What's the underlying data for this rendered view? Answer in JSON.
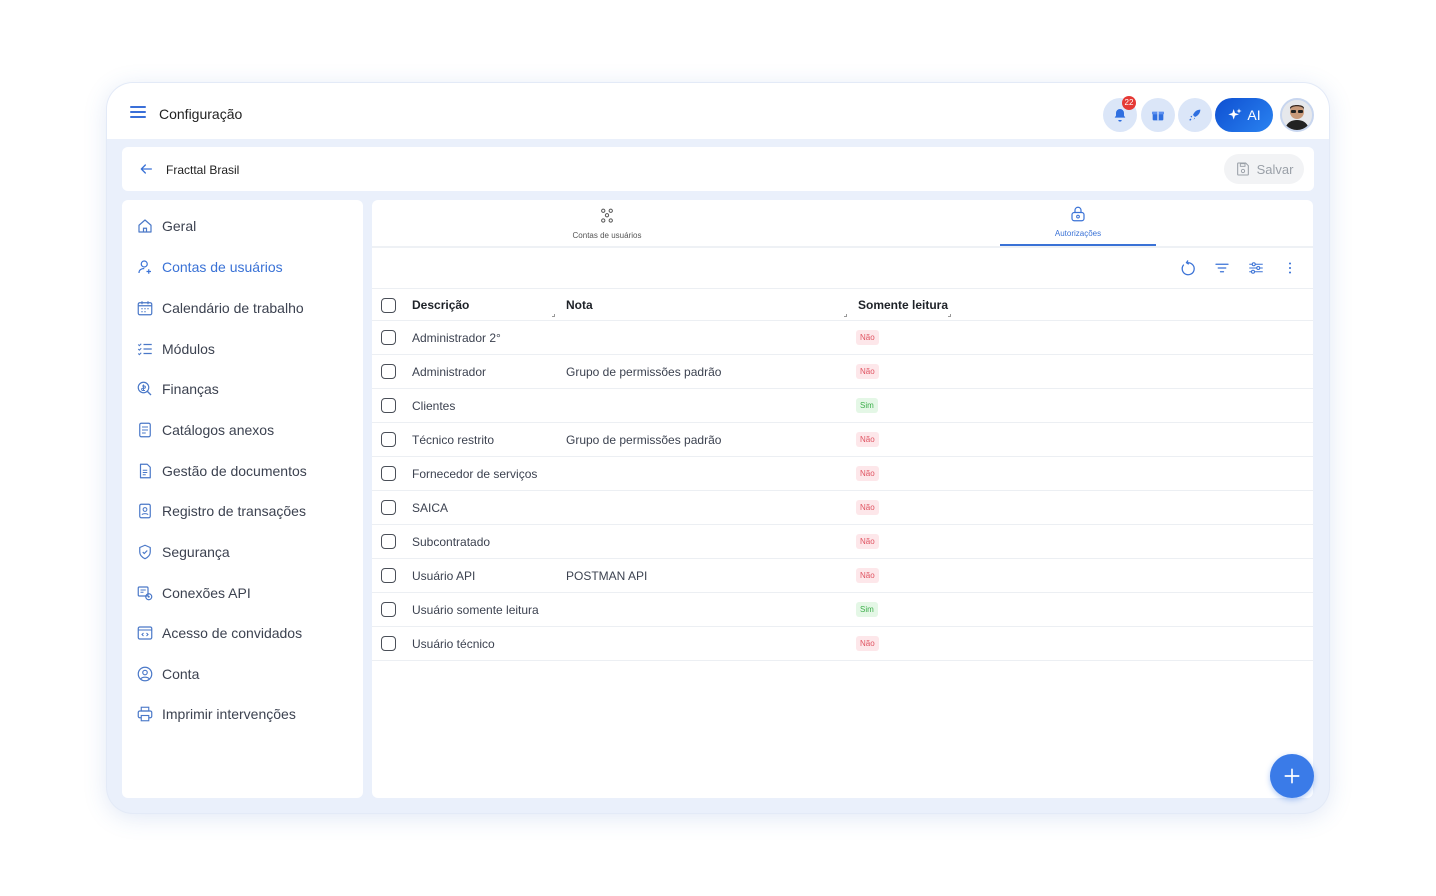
{
  "app": {
    "title": "Configuração"
  },
  "header": {
    "notifications_count": "22",
    "ai_label": "AI"
  },
  "subbar": {
    "title": "Fracttal Brasil",
    "save_label": "Salvar"
  },
  "sidebar": {
    "items": [
      {
        "label": "Geral",
        "icon": "home-icon"
      },
      {
        "label": "Contas de usuários",
        "icon": "user-icon",
        "active": true
      },
      {
        "label": "Calendário de trabalho",
        "icon": "calendar-icon"
      },
      {
        "label": "Módulos",
        "icon": "list-icon"
      },
      {
        "label": "Finanças",
        "icon": "finance-icon"
      },
      {
        "label": "Catálogos anexos",
        "icon": "catalog-icon"
      },
      {
        "label": "Gestão de documentos",
        "icon": "document-icon"
      },
      {
        "label": "Registro de transações",
        "icon": "transaction-icon"
      },
      {
        "label": "Segurança",
        "icon": "shield-icon"
      },
      {
        "label": "Conexões API",
        "icon": "api-icon"
      },
      {
        "label": "Acesso de convidados",
        "icon": "guest-icon"
      },
      {
        "label": "Conta",
        "icon": "account-icon"
      },
      {
        "label": "Imprimir intervenções",
        "icon": "printer-icon"
      }
    ]
  },
  "tabs": [
    {
      "label": "Contas de usuários"
    },
    {
      "label": "Autorizações",
      "active": true
    }
  ],
  "table": {
    "columns": [
      "Descrição",
      "Nota",
      "Somente leitura"
    ],
    "rows": [
      {
        "description": "Administrador 2°",
        "note": "",
        "readonly": "Não"
      },
      {
        "description": "Administrador",
        "note": "Grupo de permissões padrão",
        "readonly": "Não"
      },
      {
        "description": "Clientes",
        "note": "",
        "readonly": "Sim"
      },
      {
        "description": "Técnico restrito",
        "note": "Grupo de permissões padrão",
        "readonly": "Não"
      },
      {
        "description": "Fornecedor de serviços",
        "note": "",
        "readonly": "Não"
      },
      {
        "description": "SAICA",
        "note": "",
        "readonly": "Não"
      },
      {
        "description": "Subcontratado",
        "note": "",
        "readonly": "Não"
      },
      {
        "description": "Usuário API",
        "note": "POSTMAN API",
        "readonly": "Não"
      },
      {
        "description": "Usuário somente leitura",
        "note": "",
        "readonly": "Sim"
      },
      {
        "description": "Usuário técnico",
        "note": "",
        "readonly": "Não"
      }
    ]
  },
  "colors": {
    "accent": "#3a72d6",
    "no_tag": "#e05462",
    "yes_tag": "#3cae4a"
  }
}
